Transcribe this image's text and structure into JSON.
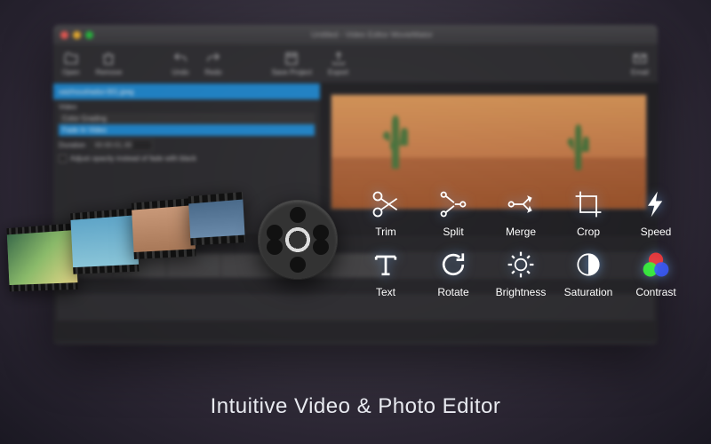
{
  "window": {
    "title": "Untitled - Video Editor MovieMator"
  },
  "toolbar": {
    "open": "Open",
    "remove": "Remove",
    "undo": "Undo",
    "redo": "Redo",
    "save_project": "Save Project",
    "export": "Export",
    "email": "Email"
  },
  "panel": {
    "tab_current": "xaizhoushadui-001.jpeg",
    "video_label": "Video",
    "items": [
      "Color Grading",
      "Fade In Video"
    ],
    "duration_label": "Duration",
    "duration_value": "00:00:01.00",
    "opacity_label": "Adjust opacity instead of fade with black"
  },
  "features": [
    {
      "id": "trim",
      "label": "Trim"
    },
    {
      "id": "split",
      "label": "Split"
    },
    {
      "id": "merge",
      "label": "Merge"
    },
    {
      "id": "crop",
      "label": "Crop"
    },
    {
      "id": "speed",
      "label": "Speed"
    },
    {
      "id": "text",
      "label": "Text"
    },
    {
      "id": "rotate",
      "label": "Rotate"
    },
    {
      "id": "brightness",
      "label": "Brightness"
    },
    {
      "id": "saturation",
      "label": "Saturation"
    },
    {
      "id": "contrast",
      "label": "Contrast"
    }
  ],
  "tagline": "Intuitive Video & Photo Editor"
}
